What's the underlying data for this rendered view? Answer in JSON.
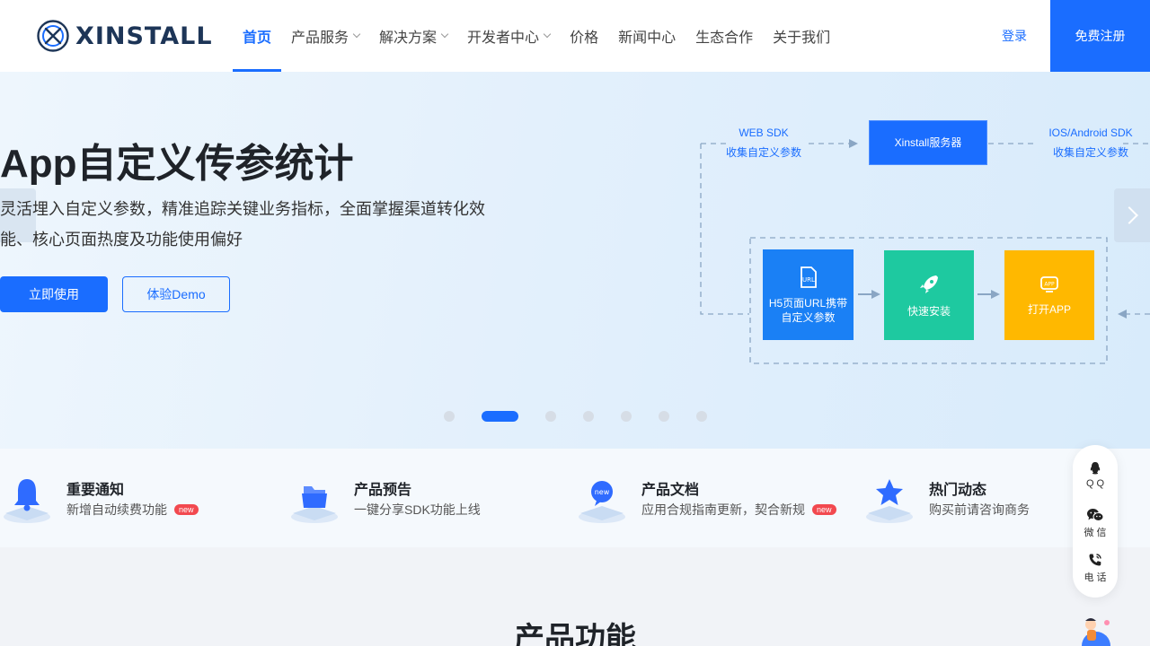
{
  "header": {
    "brand": "XINSTALL",
    "nav": [
      {
        "label": "首页",
        "active": true,
        "dropdown": false
      },
      {
        "label": "产品服务",
        "active": false,
        "dropdown": true
      },
      {
        "label": "解决方案",
        "active": false,
        "dropdown": true
      },
      {
        "label": "开发者中心",
        "active": false,
        "dropdown": true
      },
      {
        "label": "价格",
        "active": false,
        "dropdown": false
      },
      {
        "label": "新闻中心",
        "active": false,
        "dropdown": false
      },
      {
        "label": "生态合作",
        "active": false,
        "dropdown": false
      },
      {
        "label": "关于我们",
        "active": false,
        "dropdown": false
      }
    ],
    "login": "登录",
    "register": "免费注册"
  },
  "hero": {
    "title": "App自定义传参统计",
    "desc_line1": "灵活埋入自定义参数，精准追踪关键业务指标，全面掌握渠道转化效",
    "desc_line2": "能、核心页面热度及功能使用偏好",
    "primary_button": "立即使用",
    "secondary_button": "体验Demo",
    "carousel_active_index": 1,
    "carousel_count": 7
  },
  "diagram": {
    "web_sdk": "WEB SDK",
    "web_sdk_sub": "收集自定义参数",
    "server": "Xinstall服务器",
    "native_sdk": "IOS/Android SDK",
    "native_sdk_sub": "收集自定义参数",
    "step1_line1": "H5页面URL携带",
    "step1_line2": "自定义参数",
    "step1_icon_text": "URL",
    "step2": "快速安装",
    "step3": "打开APP",
    "step3_icon_text": "APP",
    "colors": {
      "blue": "#1a6dff",
      "green": "#1ec9a0",
      "yellow": "#ffb800",
      "dash": "#8aa6c4"
    }
  },
  "notices": [
    {
      "icon": "bell-icon",
      "title": "重要通知",
      "desc": "新增自动续费功能",
      "badge": "new"
    },
    {
      "icon": "folder-icon",
      "title": "产品预告",
      "desc": "一键分享SDK功能上线",
      "badge": ""
    },
    {
      "icon": "doc-new-icon",
      "icon_text": "new",
      "title": "产品文档",
      "desc": "应用合规指南更新，契合新规",
      "badge": "new"
    },
    {
      "icon": "star-icon",
      "title": "热门动态",
      "desc": "购买前请咨询商务",
      "badge": ""
    }
  ],
  "floatbar": [
    {
      "icon": "qq-icon",
      "label": "QQ"
    },
    {
      "icon": "wechat-icon",
      "label": "微信"
    },
    {
      "icon": "phone-icon",
      "label": "电话"
    }
  ],
  "product_section": {
    "title": "产品功能"
  }
}
